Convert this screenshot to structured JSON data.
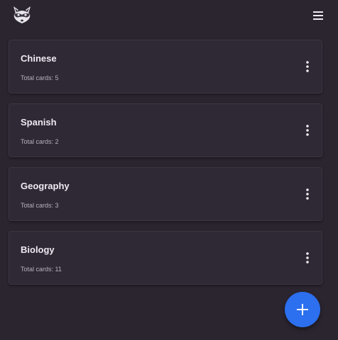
{
  "header": {
    "logo_icon": "raccoon-logo-icon",
    "menu_icon": "hamburger-menu-icon"
  },
  "decks": [
    {
      "name": "Chinese",
      "count_text": "Total cards: 5"
    },
    {
      "name": "Spanish",
      "count_text": "Total cards: 2"
    },
    {
      "name": "Geography",
      "count_text": "Total cards: 3"
    },
    {
      "name": "Biology",
      "count_text": "Total cards: 11"
    }
  ],
  "fab": {
    "icon": "plus-icon",
    "color": "#2c6fef"
  },
  "colors": {
    "background": "#2b2530",
    "card": "#2f2935",
    "text": "#eeeaf1"
  }
}
